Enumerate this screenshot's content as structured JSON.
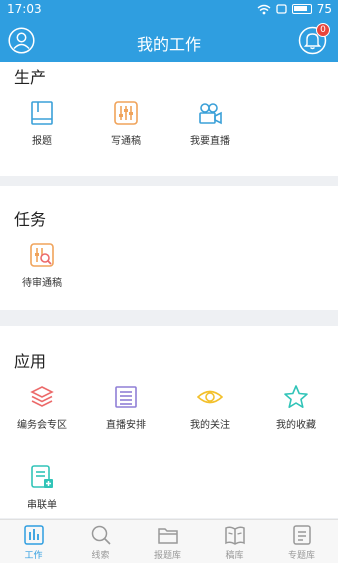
{
  "status_bar": {
    "time": "17:03",
    "battery": "75"
  },
  "header": {
    "title": "我的工作",
    "badge_count": "0"
  },
  "sections": {
    "production": {
      "title": "生产",
      "items": [
        {
          "label": "报题",
          "icon": "book-icon"
        },
        {
          "label": "写通稿",
          "icon": "sliders-icon"
        },
        {
          "label": "我要直播",
          "icon": "video-camera-icon"
        }
      ]
    },
    "tasks": {
      "title": "任务",
      "items": [
        {
          "label": "待审通稿",
          "icon": "review-sliders-icon"
        }
      ]
    },
    "apps": {
      "title": "应用",
      "items": [
        {
          "label": "编务会专区",
          "icon": "layers-icon"
        },
        {
          "label": "直播安排",
          "icon": "list-icon"
        },
        {
          "label": "我的关注",
          "icon": "eye-icon"
        },
        {
          "label": "我的收藏",
          "icon": "star-icon"
        },
        {
          "label": "串联单",
          "icon": "doc-plus-icon"
        }
      ]
    }
  },
  "tabbar": {
    "tabs": [
      {
        "label": "工作",
        "icon": "bar-chart-icon",
        "active": true
      },
      {
        "label": "线索",
        "icon": "search-icon",
        "active": false
      },
      {
        "label": "报题库",
        "icon": "folder-icon",
        "active": false
      },
      {
        "label": "稿库",
        "icon": "open-book-icon",
        "active": false
      },
      {
        "label": "专题库",
        "icon": "document-icon",
        "active": false
      }
    ]
  },
  "colors": {
    "primary": "#2f9ee0",
    "badge": "#e8453c",
    "blue_icon": "#3aa0d8",
    "orange_icon": "#f0a35a",
    "red_icon": "#ec6a6a",
    "purple_icon": "#8f7fd6",
    "yellow_icon": "#f3c02b",
    "teal_icon": "#31c4b8"
  }
}
